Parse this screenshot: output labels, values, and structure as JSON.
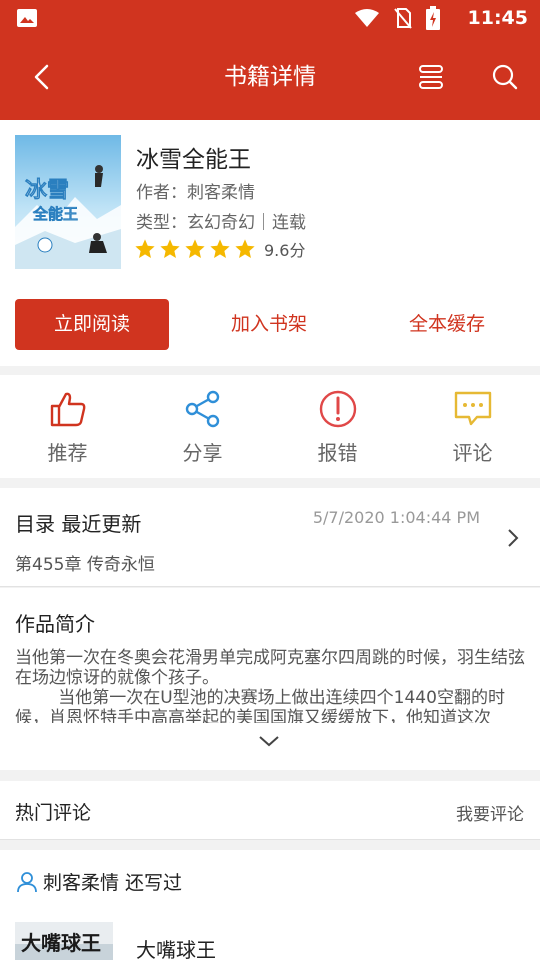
{
  "status_bar": {
    "time": "11:45"
  },
  "app_bar": {
    "title": "书籍详情"
  },
  "book": {
    "title": "冰雪全能王",
    "author": "作者：刺客柔情",
    "type": "类型：玄幻奇幻｜连载",
    "rating_score": "9.6分",
    "stars": 5,
    "cover_text": "冰雪全能王"
  },
  "buttons": {
    "read": "立即阅读",
    "shelf": "加入书架",
    "cache": "全本缓存"
  },
  "actions": [
    {
      "label": "推荐",
      "icon": "thumbs-up-icon",
      "color": "#d0341f"
    },
    {
      "label": "分享",
      "icon": "share-icon",
      "color": "#2f8fd8"
    },
    {
      "label": "报错",
      "icon": "error-icon",
      "color": "#e04848"
    },
    {
      "label": "评论",
      "icon": "comment-icon",
      "color": "#e6b934"
    }
  ],
  "toc": {
    "heading": "目录  最近更新",
    "date": "5/7/2020 1:04:44 PM",
    "chapter": "第455章 传奇永恒"
  },
  "intro": {
    "heading": "作品简介",
    "text": "当他第一次在冬奥会花滑男单完成阿克塞尔四周跳的时候，羽生结弦在场边惊讶的就像个孩子。\n        当他第一次在U型池的决赛场上做出连续四个1440空翻的时候，肖恩怀特手中高高举起的美国国旗又缓缓放下，他知道这次"
  },
  "comments": {
    "heading": "热门评论",
    "write_link": "我要评论"
  },
  "also_wrote": {
    "heading": "刺客柔情  还写过",
    "book_title": "大嘴球王",
    "thumb_text": "大嘴球王"
  },
  "colors": {
    "brand": "#d0341f",
    "star": "#f5b800"
  }
}
